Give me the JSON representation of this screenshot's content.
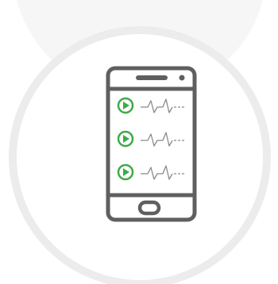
{
  "illustration": {
    "subject": "mobile-phone-audio-list",
    "track_count": 3,
    "colors": {
      "background_disc": "#f6f6f6",
      "ring": "#ececec",
      "phone_stroke": "#5f5f5f",
      "play_accent": "#3eaa48",
      "waveform": "#8a8a8a"
    },
    "icons": [
      "phone-icon",
      "play-icon",
      "waveform-icon"
    ]
  }
}
